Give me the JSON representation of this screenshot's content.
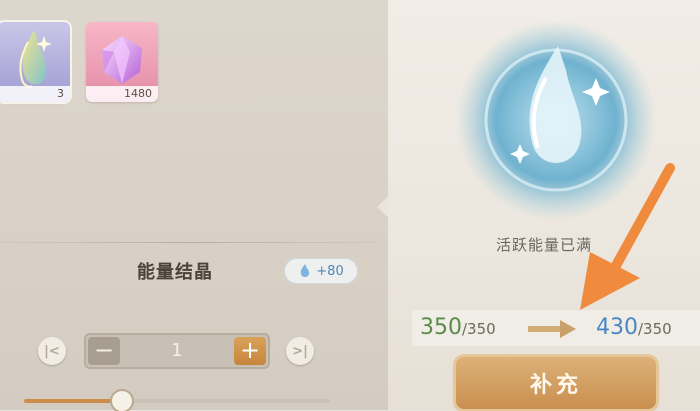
{
  "items": [
    {
      "name_icon": "energy-crystal-icon",
      "count": "3",
      "selected": true
    },
    {
      "name_icon": "pink-gem-icon",
      "count": "1480",
      "selected": false
    }
  ],
  "selected_item": {
    "name": "能量结晶",
    "energy_bonus": "+80"
  },
  "quantity": {
    "value": "1",
    "min_label": "min",
    "max_label": "max",
    "slider_fraction": 0.32
  },
  "status": {
    "full_text": "活跃能量已满"
  },
  "energy": {
    "current": "350",
    "current_max": "/350",
    "after": "430",
    "after_max": "/350"
  },
  "actions": {
    "refill_label": "补充"
  },
  "colors": {
    "accent_orange": "#f08a3c",
    "current_green": "#5b8a4a",
    "after_blue": "#4a86c3"
  }
}
